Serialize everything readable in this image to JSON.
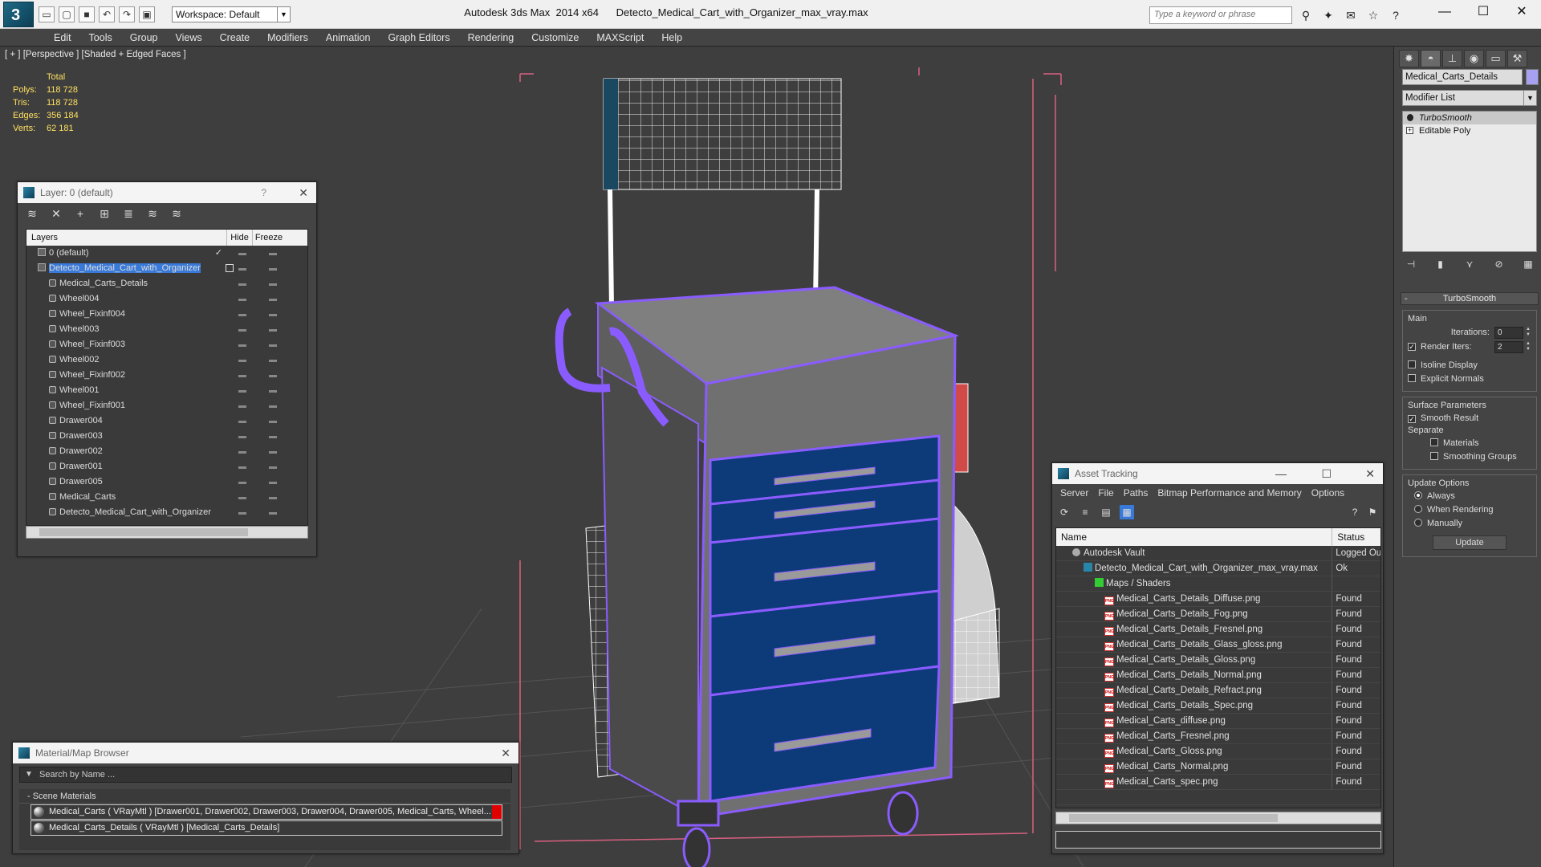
{
  "titlebar": {
    "logo_letter": "3",
    "window_title": "Autodesk 3ds Max  2014 x64      Detecto_Medical_Cart_with_Organizer_max_vray.max",
    "workspace": "Workspace: Default",
    "search_placeholder": "Type a keyword or phrase"
  },
  "menu": [
    "Edit",
    "Tools",
    "Group",
    "Views",
    "Create",
    "Modifiers",
    "Animation",
    "Graph Editors",
    "Rendering",
    "Customize",
    "MAXScript",
    "Help"
  ],
  "viewport": {
    "label": "[ + ] [Perspective ] [Shaded + Edged Faces ]",
    "stats": {
      "header": "Total",
      "rows": [
        {
          "k": "Polys:",
          "v": "118 728"
        },
        {
          "k": "Tris:",
          "v": "118 728"
        },
        {
          "k": "Edges:",
          "v": "356 184"
        },
        {
          "k": "Verts:",
          "v": "62 181"
        }
      ]
    }
  },
  "layer_window": {
    "title": "Layer: 0 (default)",
    "help": "?",
    "columns": {
      "name": "Layers",
      "hide": "Hide",
      "freeze": "Freeze"
    },
    "rows": [
      {
        "name": "0 (default)",
        "level": 1,
        "kind": "layer",
        "checked": true
      },
      {
        "name": "Detecto_Medical_Cart_with_Organizer",
        "level": 1,
        "kind": "layer",
        "selected": true
      },
      {
        "name": "Medical_Carts_Details",
        "level": 2,
        "kind": "object"
      },
      {
        "name": "Wheel004",
        "level": 2,
        "kind": "object"
      },
      {
        "name": "Wheel_Fixinf004",
        "level": 2,
        "kind": "object"
      },
      {
        "name": "Wheel003",
        "level": 2,
        "kind": "object"
      },
      {
        "name": "Wheel_Fixinf003",
        "level": 2,
        "kind": "object"
      },
      {
        "name": "Wheel002",
        "level": 2,
        "kind": "object"
      },
      {
        "name": "Wheel_Fixinf002",
        "level": 2,
        "kind": "object"
      },
      {
        "name": "Wheel001",
        "level": 2,
        "kind": "object"
      },
      {
        "name": "Wheel_Fixinf001",
        "level": 2,
        "kind": "object"
      },
      {
        "name": "Drawer004",
        "level": 2,
        "kind": "object"
      },
      {
        "name": "Drawer003",
        "level": 2,
        "kind": "object"
      },
      {
        "name": "Drawer002",
        "level": 2,
        "kind": "object"
      },
      {
        "name": "Drawer001",
        "level": 2,
        "kind": "object"
      },
      {
        "name": "Drawer005",
        "level": 2,
        "kind": "object"
      },
      {
        "name": "Medical_Carts",
        "level": 2,
        "kind": "object"
      },
      {
        "name": "Detecto_Medical_Cart_with_Organizer",
        "level": 2,
        "kind": "object"
      }
    ]
  },
  "material_browser": {
    "title": "Material/Map Browser",
    "search_placeholder": "Search by Name ...",
    "group": "- Scene Materials",
    "items": [
      "Medical_Carts  ( VRayMtl )  [Drawer001, Drawer002, Drawer003, Drawer004, Drawer005, Medical_Carts, Wheel...",
      "Medical_Carts_Details ( VRayMtl ) [Medical_Carts_Details]"
    ]
  },
  "asset_tracking": {
    "title": "Asset Tracking",
    "menu": [
      "Server",
      "File",
      "Paths",
      "Bitmap Performance and Memory",
      "Options"
    ],
    "columns": {
      "name": "Name",
      "status": "Status"
    },
    "rows": [
      {
        "name": "Autodesk Vault",
        "status": "Logged Out",
        "level": 1,
        "icon": "vault"
      },
      {
        "name": "Detecto_Medical_Cart_with_Organizer_max_vray.max",
        "status": "Ok",
        "level": 2,
        "icon": "max"
      },
      {
        "name": "Maps / Shaders",
        "status": "",
        "level": 3,
        "icon": "maps"
      },
      {
        "name": "Medical_Carts_Details_Diffuse.png",
        "status": "Found",
        "level": 4,
        "icon": "png"
      },
      {
        "name": "Medical_Carts_Details_Fog.png",
        "status": "Found",
        "level": 4,
        "icon": "png"
      },
      {
        "name": "Medical_Carts_Details_Fresnel.png",
        "status": "Found",
        "level": 4,
        "icon": "png"
      },
      {
        "name": "Medical_Carts_Details_Glass_gloss.png",
        "status": "Found",
        "level": 4,
        "icon": "png"
      },
      {
        "name": "Medical_Carts_Details_Gloss.png",
        "status": "Found",
        "level": 4,
        "icon": "png"
      },
      {
        "name": "Medical_Carts_Details_Normal.png",
        "status": "Found",
        "level": 4,
        "icon": "png"
      },
      {
        "name": "Medical_Carts_Details_Refract.png",
        "status": "Found",
        "level": 4,
        "icon": "png"
      },
      {
        "name": "Medical_Carts_Details_Spec.png",
        "status": "Found",
        "level": 4,
        "icon": "png"
      },
      {
        "name": "Medical_Carts_diffuse.png",
        "status": "Found",
        "level": 4,
        "icon": "png"
      },
      {
        "name": "Medical_Carts_Fresnel.png",
        "status": "Found",
        "level": 4,
        "icon": "png"
      },
      {
        "name": "Medical_Carts_Gloss.png",
        "status": "Found",
        "level": 4,
        "icon": "png"
      },
      {
        "name": "Medical_Carts_Normal.png",
        "status": "Found",
        "level": 4,
        "icon": "png"
      },
      {
        "name": "Medical_Carts_spec.png",
        "status": "Found",
        "level": 4,
        "icon": "png"
      }
    ]
  },
  "command_panel": {
    "object_name": "Medical_Carts_Details",
    "object_color": "#a8a0f0",
    "modifier_list": "Modifier List",
    "stack": [
      {
        "name": "TurboSmooth",
        "active": true
      },
      {
        "name": "Editable Poly",
        "active": false
      }
    ],
    "turbosmooth": {
      "title": "TurboSmooth",
      "main": "Main",
      "iterations_label": "Iterations:",
      "iterations": "0",
      "render_iters_label": "Render Iters:",
      "render_iters": "2",
      "isoline": "Isoline Display",
      "explicit_normals": "Explicit Normals",
      "surface_params": "Surface Parameters",
      "smooth_result": "Smooth Result",
      "separate": "Separate",
      "materials": "Materials",
      "smoothing_groups": "Smoothing Groups",
      "update_options": "Update Options",
      "always": "Always",
      "when_rendering": "When Rendering",
      "manually": "Manually",
      "update_button": "Update"
    }
  },
  "colors": {
    "accent": "#3979d8",
    "wire_select": "#8a5cff",
    "drawer": "#0d3a78",
    "viewport_bg": "#3e3e3e"
  }
}
